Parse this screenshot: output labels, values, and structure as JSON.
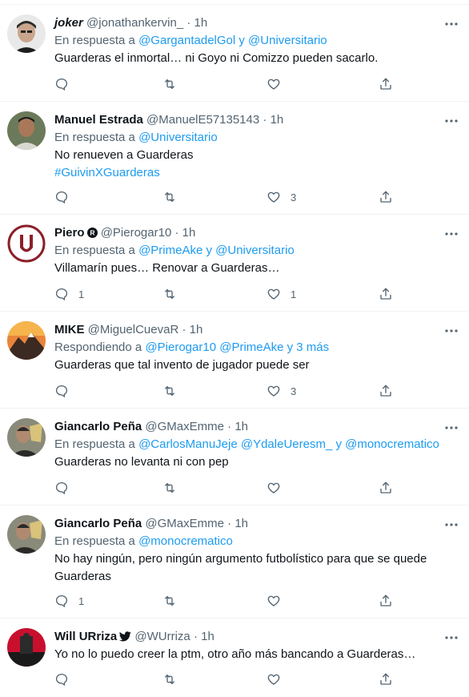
{
  "tweets": [
    {
      "name": "joker",
      "handle": "@jonathankervin_",
      "time": "1h",
      "reply_prefix": "En respuesta a",
      "mentions": "@GargantadelGol y @Universitario",
      "lines": [
        "Guarderas el inmortal… ni Goyo ni Comizzo pueden sacarlo."
      ],
      "replies": "",
      "likes": ""
    },
    {
      "name": "Manuel Estrada",
      "handle": "@ManuelE57135143",
      "time": "1h",
      "reply_prefix": "En respuesta a",
      "mentions": "@Universitario",
      "lines": [
        "No renueven a Guarderas"
      ],
      "hashtag": "#GuivinXGuarderas",
      "replies": "",
      "likes": "3"
    },
    {
      "name": "Piero",
      "badge": "R",
      "handle": "@Pierogar10",
      "time": "1h",
      "reply_prefix": "En respuesta a",
      "mentions": "@PrimeAke y @Universitario",
      "lines": [
        "Villamarín pues… Renovar a Guarderas…"
      ],
      "replies": "1",
      "likes": "1"
    },
    {
      "name": "MIKE",
      "handle": "@MiguelCuevaR",
      "time": "1h",
      "reply_prefix": "Respondiendo a",
      "mentions": "@Pierogar10 @PrimeAke y 3 más",
      "lines": [
        "Guarderas que tal invento de jugador puede ser"
      ],
      "replies": "",
      "likes": "3"
    },
    {
      "name": "Giancarlo Peña",
      "handle": "@GMaxEmme",
      "time": "1h",
      "reply_prefix": "En respuesta a",
      "mentions": "@CarlosManuJeje @YdaleUeresm_ y @monocrematico",
      "lines": [
        "Guarderas no levanta ni con pep"
      ],
      "replies": "",
      "likes": ""
    },
    {
      "name": "Giancarlo Peña",
      "handle": "@GMaxEmme",
      "time": "1h",
      "reply_prefix": "En respuesta a",
      "mentions": "@monocrematico",
      "lines": [
        "No hay ningún, pero ningún argumento futbolístico para que se quede",
        "Guarderas"
      ],
      "replies": "1",
      "likes": ""
    },
    {
      "name": "Will URriza",
      "handle": "@WUrriza",
      "time": "1h",
      "lines": [
        "Yo no lo puedo creer la ptm, otro año más bancando a Guarderas…"
      ],
      "replies": "",
      "likes": ""
    }
  ],
  "separator": "·",
  "colors": {
    "accent": "#1d9bf0",
    "muted": "#536471",
    "text": "#0f1419",
    "border": "#eff3f4"
  }
}
